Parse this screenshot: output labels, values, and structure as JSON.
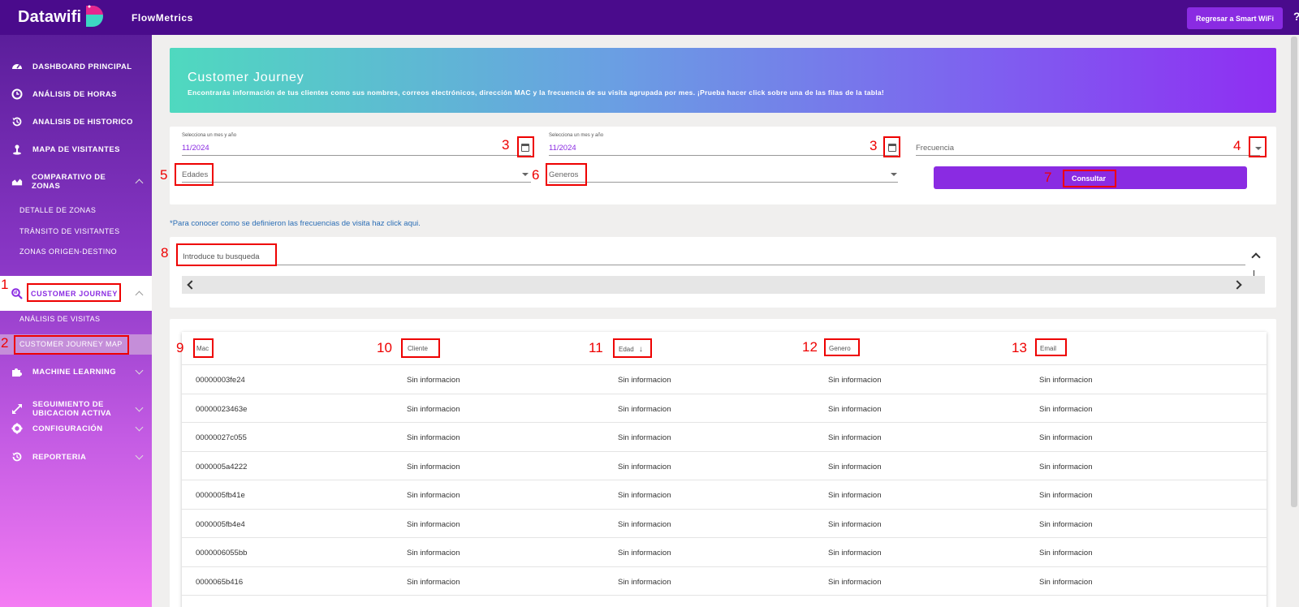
{
  "header": {
    "logo_text": "Datawifi",
    "product_name": "FlowMetrics",
    "back_button": "Regresar a Smart WiFi",
    "help": "?"
  },
  "sidebar": {
    "items": [
      {
        "label": "DASHBOARD PRINCIPAL",
        "icon": "dashboard-icon"
      },
      {
        "label": "ANÁLISIS DE HORAS",
        "icon": "clock-icon"
      },
      {
        "label": "ANALISIS DE HISTORICO",
        "icon": "history-icon"
      },
      {
        "label": "MAPA DE VISITANTES",
        "icon": "map-pin-icon"
      },
      {
        "label1": "COMPARATIVO DE",
        "label2": "ZONAS",
        "icon": "area-chart-icon"
      }
    ],
    "zonas_sub": [
      "DETALLE DE ZONAS",
      "TRÁNSITO DE VISITANTES",
      "ZONAS ORIGEN-DESTINO"
    ],
    "customer_journey": "CUSTOMER JOURNEY",
    "cj_sub": [
      "ANÁLISIS DE VISITAS",
      "CUSTOMER JOURNEY MAP"
    ],
    "bottom_items": [
      {
        "label": "MACHINE LEARNING",
        "icon": "puzzle-icon"
      },
      {
        "label1": "SEGUIMIENTO DE",
        "label2": "UBICACION ACTIVA",
        "icon": "expand-icon"
      },
      {
        "label": "CONFIGURACIÓN",
        "icon": "gear-icon"
      },
      {
        "label": "REPORTERIA",
        "icon": "history-icon"
      }
    ]
  },
  "hero": {
    "title": "Customer Journey",
    "description": "Encontrarás información de tus clientes como sus nombres, correos electrónicos, dirección MAC y la frecuencia de su visita agrupada por mes. ¡Prueba hacer click sobre una de las filas de la tabla!"
  },
  "filters": {
    "date_label": "Selecciona un mes y año",
    "date_from": "11/2024",
    "date_to": "11/2024",
    "frecuencia_placeholder": "Frecuencia",
    "edades_placeholder": "Edades",
    "generos_placeholder": "Generos",
    "consultar": "Consultar"
  },
  "note": "*Para conocer como se definieron las frecuencias de visita haz click aqui.",
  "search": {
    "placeholder": "Introduce tu busqueda"
  },
  "table": {
    "columns": [
      "Mac",
      "Cliente",
      "Edad",
      "Genero",
      "Email"
    ],
    "empty_value": "Sin informacion",
    "rows": [
      "00000003fe24",
      "00000023463e",
      "00000027c055",
      "0000005a4222",
      "0000005fb41e",
      "0000005fb4e4",
      "0000006055bb",
      "0000065b416"
    ]
  },
  "annotations": [
    "1",
    "2",
    "3",
    "3",
    "4",
    "5",
    "6",
    "7",
    "8",
    "9",
    "10",
    "11",
    "12",
    "13"
  ]
}
